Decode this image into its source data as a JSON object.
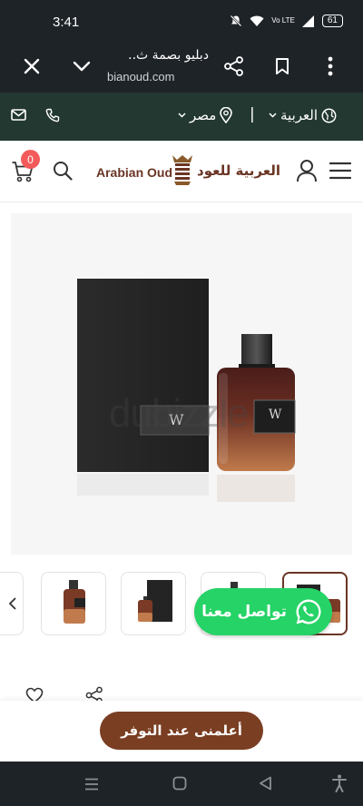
{
  "status_bar": {
    "time": "3:41",
    "battery": "61",
    "icons": [
      "mute-icon",
      "wifi-icon",
      "volte-icon",
      "signal-icon",
      "battery-icon"
    ],
    "volte_label": "Vo LTE"
  },
  "browser": {
    "page_title": "دبليو بصمة ث..",
    "url": "bianoud.com",
    "icons": [
      "close-icon",
      "chevron-down-icon",
      "share-icon",
      "bookmark-icon",
      "more-vert-icon"
    ]
  },
  "top_strip": {
    "language": "العربية",
    "country": "مصر",
    "icons": [
      "mail-icon",
      "phone-icon",
      "location-pin-icon",
      "globe-icon"
    ]
  },
  "header": {
    "cart_count": "0",
    "logo_latin": "Arabian Oud",
    "logo_arabic": "العربية للعود",
    "icons": [
      "cart-icon",
      "search-icon",
      "user-icon",
      "menu-icon"
    ]
  },
  "product": {
    "watermark": "dubizzle",
    "bottle_label": "W",
    "box_label": "W"
  },
  "thumbnails": {
    "selected_index": 3,
    "count": 4
  },
  "whatsapp": {
    "label": "تواصل معنا"
  },
  "actions": {
    "notify_label": "أعلمنى عند التوفر",
    "icons": [
      "heart-icon",
      "share-icon"
    ]
  },
  "nav_bar": {
    "icons": [
      "recent-apps-icon",
      "home-icon",
      "back-icon",
      "accessibility-icon"
    ]
  },
  "colors": {
    "dark_bar": "#1e2328",
    "strip_green": "#223830",
    "brand_brown": "#6a3524",
    "notify_button": "#7a3e22",
    "whatsapp_green": "#25d366",
    "cart_badge": "#f35b5b"
  }
}
